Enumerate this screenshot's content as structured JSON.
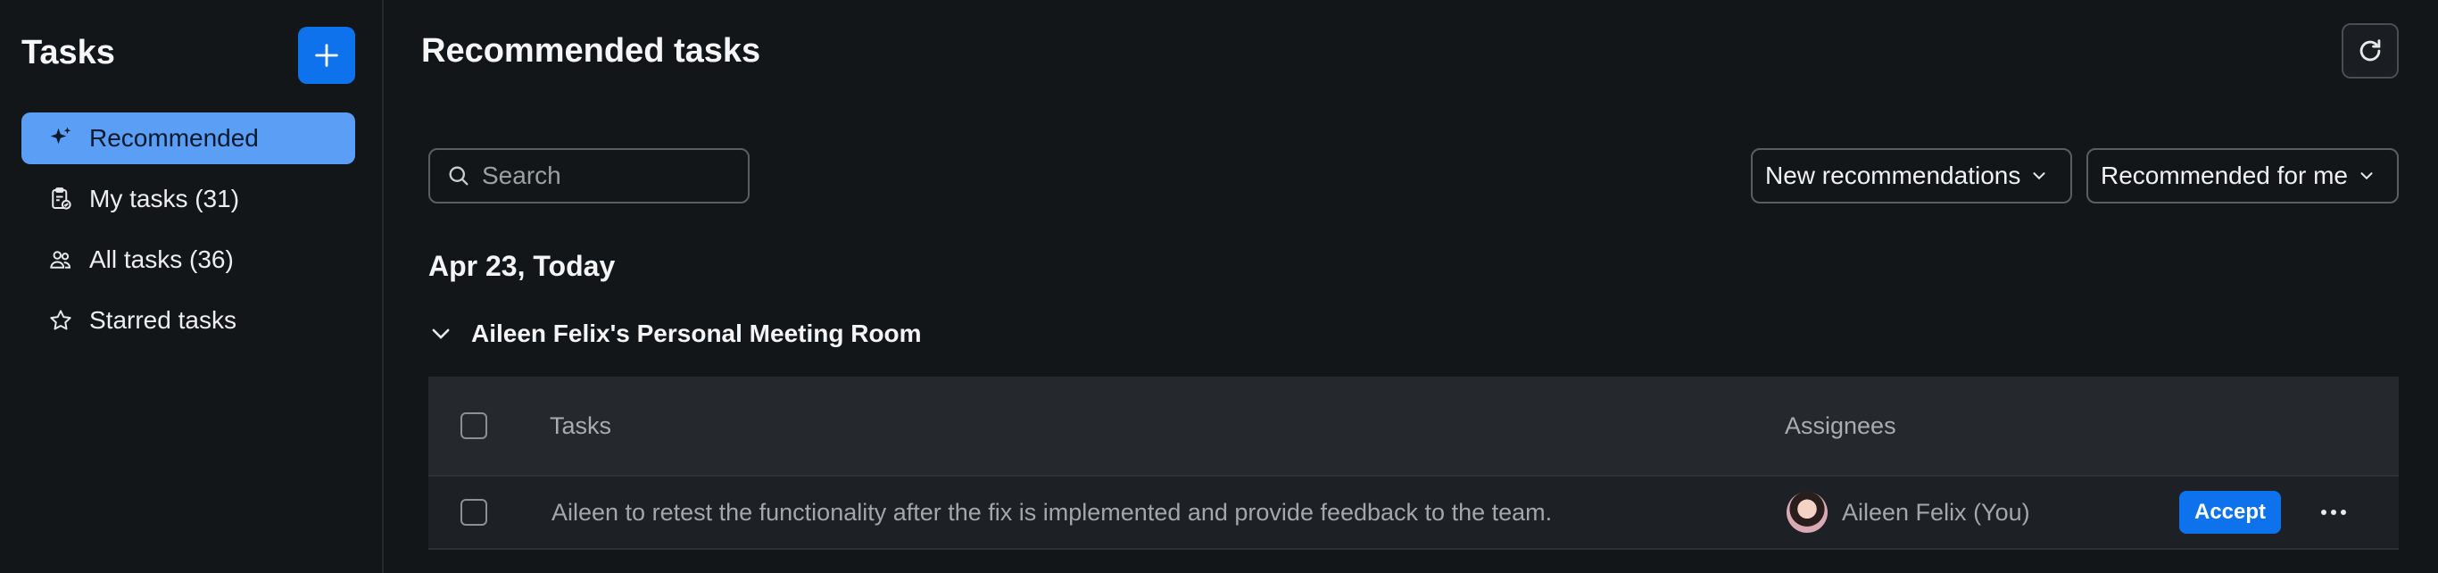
{
  "sidebar": {
    "title": "Tasks",
    "new_icon": "plus-icon",
    "items": [
      {
        "label": "Recommended",
        "icon": "sparkle-icon",
        "active": true
      },
      {
        "label": "My tasks (31)",
        "icon": "clipboard-check-icon"
      },
      {
        "label": "All tasks (36)",
        "icon": "people-icon"
      },
      {
        "label": "Starred tasks",
        "icon": "star-icon"
      }
    ]
  },
  "main": {
    "title": "Recommended tasks",
    "refresh_icon": "refresh-icon",
    "search": {
      "placeholder": "Search",
      "value": ""
    },
    "filters": [
      {
        "label": "New recommendations"
      },
      {
        "label": "Recommended for me"
      }
    ],
    "date_heading": "Apr 23, Today",
    "group": {
      "title": "Aileen Felix's Personal Meeting Room",
      "expanded": true
    },
    "table": {
      "columns": [
        "Tasks",
        "Assignees"
      ],
      "rows": [
        {
          "task": "Aileen to retest the functionality after the fix is implemented and provide feedback to the team.",
          "assignee": "Aileen Felix (You)",
          "action": "Accept"
        }
      ]
    }
  },
  "colors": {
    "accent": "#0e72ed",
    "active_item": "#5b9ef6",
    "background": "#131619"
  }
}
